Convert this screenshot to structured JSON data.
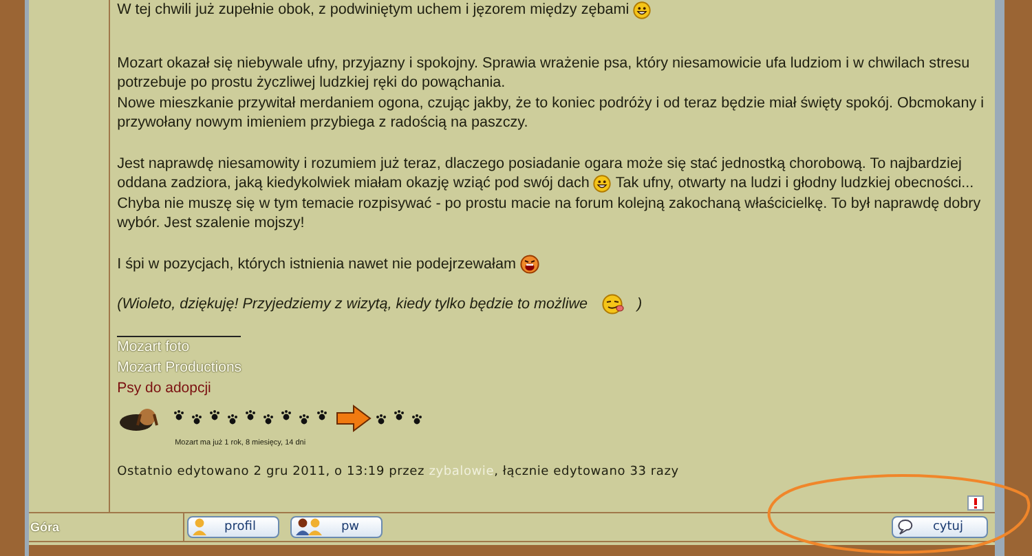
{
  "post": {
    "paragraphs": [
      {
        "italic": false,
        "lines": [
          [
            {
              "kind": "text",
              "text": "W tej chwili już zupełnie obok, z podwiniętym uchem i jęzorem między zębami"
            },
            {
              "kind": "grin"
            }
          ]
        ]
      },
      {
        "italic": false,
        "lines": [
          [
            {
              "kind": "text",
              "text": "Mozart okazał się niebywale ufny, przyjazny i spokojny. Sprawia wrażenie psa, który niesamowicie ufa ludziom i w chwilach stresu"
            }
          ],
          [
            {
              "kind": "text",
              "text": "potrzebuje po prostu życzliwej ludzkiej ręki do powąchania."
            }
          ],
          [
            {
              "kind": "text",
              "text": "Nowe mieszkanie przywitał merdaniem ogona, czując jakby, że to koniec podróży i od teraz będzie miał święty spokój. Obcmokany i"
            }
          ],
          [
            {
              "kind": "text",
              "text": "przywołany nowym imieniem przybiega z radością na paszczy."
            }
          ]
        ]
      },
      {
        "italic": false,
        "lines": [
          [
            {
              "kind": "text",
              "text": "Jest naprawdę niesamowity i rozumiem już teraz, dlaczego posiadanie ogara może się stać jednostką chorobową. To najbardziej"
            }
          ],
          [
            {
              "kind": "text",
              "text": "oddana zadziora, jaką kiedykolwiek miałam okazję wziąć pod swój dach"
            },
            {
              "kind": "grin"
            },
            {
              "kind": "text",
              "text": "Tak ufny, otwarty na ludzi i głodny ludzkiej obecności..."
            }
          ],
          [
            {
              "kind": "text",
              "text": "Chyba nie muszę się w tym temacie rozpisywać - po prostu macie na forum kolejną zakochaną właścicielkę. To był naprawdę dobry"
            }
          ],
          [
            {
              "kind": "text",
              "text": "wybór. Jest szalenie mojszy!"
            }
          ]
        ]
      },
      {
        "italic": false,
        "lines": [
          [
            {
              "kind": "text",
              "text": "I śpi w pozycjach, których istnienia nawet nie podejrzewałam"
            },
            {
              "kind": "laugh"
            }
          ]
        ]
      },
      {
        "italic": true,
        "lines": [
          [
            {
              "kind": "text",
              "text": "(Wioleto, dziękuję! Przyjedziemy z wizytą, kiedy tylko będzie to możliwe"
            },
            {
              "kind": "tongue"
            },
            {
              "kind": "text",
              "text": ")"
            }
          ]
        ]
      }
    ],
    "signature": {
      "links": [
        {
          "kind": "light",
          "text": "Mozart foto"
        },
        {
          "kind": "light",
          "text": "Mozart Productions"
        },
        {
          "kind": "dark",
          "text": "Psy do adopcji"
        }
      ],
      "ticker_caption": "Mozart ma już 1 rok, 8 miesięcy, 14 dni"
    },
    "edit_note": {
      "before": "Ostatnio edytowano 2 gru 2011, o 13:19 przez",
      "user": "zybalowie",
      "after": ", łącznie edytowano 33 razy"
    }
  },
  "footer": {
    "top_link": "Góra",
    "buttons": [
      {
        "kind": "profile",
        "label": "profil"
      },
      {
        "kind": "pm",
        "label": "pw"
      }
    ],
    "quote_button": "cytuj"
  }
}
